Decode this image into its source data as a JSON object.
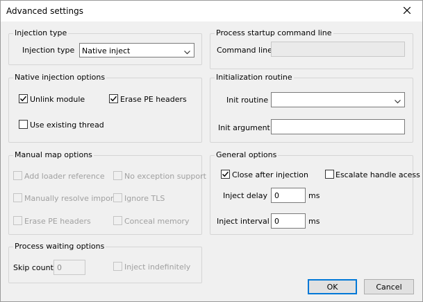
{
  "window": {
    "title": "Advanced settings",
    "close_glyph": "close-icon"
  },
  "injection_type": {
    "group_title": "Injection type",
    "label": "Injection type",
    "selected": "Native inject"
  },
  "process_startup": {
    "group_title": "Process startup command line",
    "label": "Command line",
    "value": ""
  },
  "native_injection": {
    "group_title": "Native injection options",
    "unlink_module": {
      "label": "Unlink module",
      "checked": true
    },
    "erase_pe_headers": {
      "label": "Erase PE headers",
      "checked": true
    },
    "use_existing_thread": {
      "label": "Use existing thread",
      "checked": false
    }
  },
  "init_routine": {
    "group_title": "Initialization routine",
    "routine_label": "Init routine",
    "routine_value": "",
    "argument_label": "Init argument",
    "argument_value": ""
  },
  "manual_map": {
    "group_title": "Manual map options",
    "add_loader_reference": "Add loader reference",
    "no_exception_support": "No exception support",
    "manually_resolve_imports": "Manually resolve imports",
    "ignore_tls": "Ignore TLS",
    "erase_pe_headers": "Erase PE headers",
    "conceal_memory": "Conceal memory"
  },
  "general": {
    "group_title": "General options",
    "close_after_injection": {
      "label": "Close after injection",
      "checked": true
    },
    "escalate_handle_access": {
      "label": "Escalate handle acess",
      "checked": false
    },
    "inject_delay_label": "Inject delay",
    "inject_delay_value": "0",
    "inject_delay_unit": "ms",
    "inject_interval_label": "Inject interval",
    "inject_interval_value": "0",
    "inject_interval_unit": "ms"
  },
  "process_waiting": {
    "group_title": "Process waiting options",
    "skip_count_label": "Skip count",
    "skip_count_value": "0",
    "inject_indefinitely": "Inject indefinitely"
  },
  "buttons": {
    "ok": "OK",
    "cancel": "Cancel"
  },
  "colors": {
    "focus_blue": "#0078d7",
    "window_bg": "#f0f0f0"
  }
}
